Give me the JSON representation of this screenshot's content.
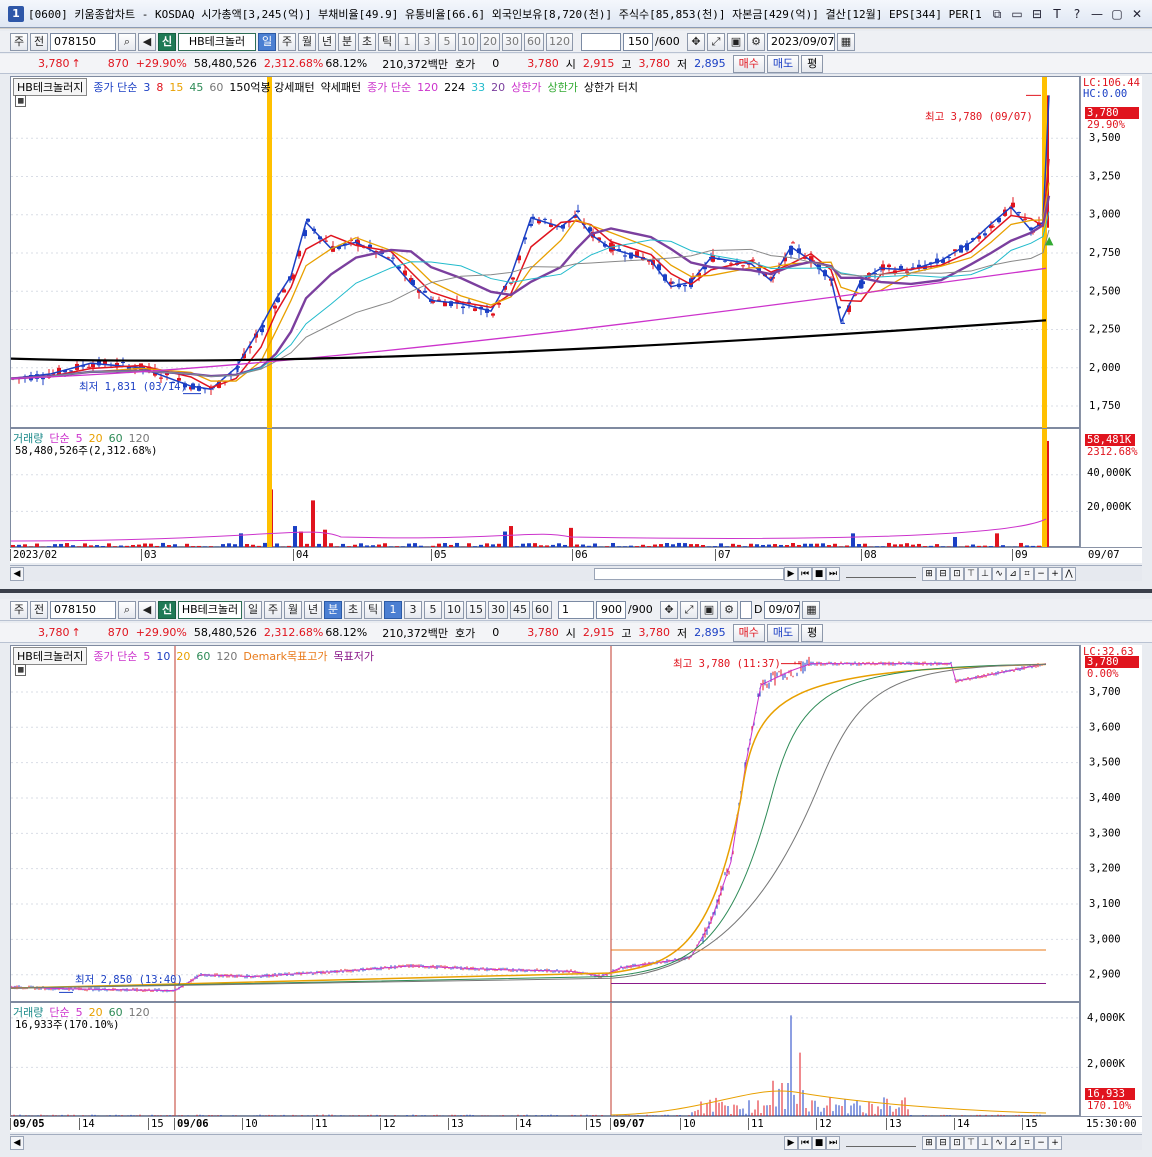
{
  "window": {
    "badge": "1",
    "title": "[0600] 키움종합차트 - KOSDAQ 시가총액[3,245(억)] 부채비율[49.9] 유통비율[66.6] 외국인보유[8,720(천)] 주식수[85,853(천)] 자본금[429(억)] 결산[12월] EPS[344] PER[1",
    "controls": [
      "⧉",
      "▭",
      "⊟",
      "T",
      "?",
      "—",
      "▢",
      "✕"
    ]
  },
  "top": {
    "toolbar": {
      "market": "주",
      "prev": "전",
      "code": "078150",
      "sin": "신",
      "indicator": "HB테크놀러",
      "periods": [
        "일",
        "주",
        "월",
        "년",
        "분",
        "초",
        "틱"
      ],
      "active_period": "일",
      "ticks": [
        "1",
        "3",
        "5",
        "10",
        "20",
        "30",
        "60",
        "120"
      ],
      "count": "150",
      "count_total": "/600",
      "date": "2023/09/07"
    },
    "quote": {
      "price": "3,780",
      "arrow": "↑",
      "change": "870",
      "rate": "+29.90%",
      "volume": "58,480,526",
      "vol_rate": "2,312.68%",
      "turnover": "68.12%",
      "amount": "210,372백만",
      "hoga_label": "호가",
      "hoga_val": "0",
      "cur": "3,780",
      "open_label": "시",
      "open": "2,915",
      "high_label": "고",
      "high": "3,780",
      "low_label": "저",
      "low": "2,895",
      "buy": "매수",
      "sell": "매도",
      "avg": "평"
    },
    "legend": {
      "box": "HB테크놀러지",
      "ma_label": "종가 단순",
      "ma": [
        "3",
        "8",
        "15",
        "45",
        "60"
      ],
      "p1": "150억봉 강세패턴",
      "p2": "약세패턴",
      "ma2_label": "종가 단순",
      "ma2": [
        "120",
        "224",
        "33",
        "20"
      ],
      "limit1": "상한가",
      "limit2": "상한가",
      "limit3": "상한가 터치"
    },
    "price_axis": [
      "3,500",
      "3,250",
      "3,000",
      "2,750",
      "2,500",
      "2,250",
      "2,000",
      "1,750"
    ],
    "lc": "LC:106.44",
    "hc": "HC:0.00",
    "last_price": "3,780",
    "last_rate": "29.90%",
    "high_note": "최고 3,780 (09/07)",
    "low_note": "최저 1,831 (03/14)",
    "vol_legend": {
      "label": "거래량",
      "ma_label": "단순",
      "ma": [
        "5",
        "20",
        "60",
        "120"
      ],
      "value": "58,480,526주(2,312.68%)"
    },
    "vol_axis": [
      "40,000K",
      "20,000K"
    ],
    "vol_last": "58,481K",
    "vol_rate": "2312.68%",
    "dates": [
      "2023/02",
      "03",
      "04",
      "05",
      "06",
      "07",
      "08",
      "09",
      "09/07"
    ]
  },
  "bottom": {
    "toolbar": {
      "market": "주",
      "prev": "전",
      "code": "078150",
      "sin": "신",
      "indicator": "HB테크놀러",
      "periods": [
        "일",
        "주",
        "월",
        "년",
        "분",
        "초",
        "틱"
      ],
      "active_period": "분",
      "ticks": [
        "1",
        "3",
        "5",
        "10",
        "15",
        "30",
        "45",
        "60"
      ],
      "active_tick": "1",
      "unit": "1",
      "count": "900",
      "count_total": "/900",
      "date": "09/07",
      "d_label": "D"
    },
    "quote": {
      "price": "3,780",
      "arrow": "↑",
      "change": "870",
      "rate": "+29.90%",
      "volume": "58,480,526",
      "vol_rate": "2,312.68%",
      "turnover": "68.12%",
      "amount": "210,372백만",
      "hoga_label": "호가",
      "hoga_val": "0",
      "cur": "3,780",
      "open_label": "시",
      "open": "2,915",
      "high_label": "고",
      "high": "3,780",
      "low_label": "저",
      "low": "2,895",
      "buy": "매수",
      "sell": "매도",
      "avg": "평"
    },
    "legend": {
      "box": "HB테크놀러지",
      "ma_label": "종가 단순",
      "ma": [
        "5",
        "10",
        "20",
        "60",
        "120"
      ],
      "demark_hi": "Demark목표고가",
      "demark_lo": "목표저가"
    },
    "price_axis": [
      "3,700",
      "3,600",
      "3,500",
      "3,400",
      "3,300",
      "3,200",
      "3,100",
      "3,000",
      "2,900"
    ],
    "lc": "LC:32.63",
    "last_price": "3,780",
    "last_rate": "0.00%",
    "high_note": "최고 3,780 (11:37)",
    "low_note": "최저 2,850 (13:40)",
    "vol_legend": {
      "label": "거래량",
      "ma_label": "단순",
      "ma": [
        "5",
        "20",
        "60",
        "120"
      ],
      "value": "16,933주(170.10%)"
    },
    "vol_axis": [
      "4,000K",
      "2,000K"
    ],
    "vol_last": "16,933",
    "vol_rate": "170.10%",
    "times": [
      "09/05",
      "14",
      "15",
      "09/06",
      "10",
      "11",
      "12",
      "13",
      "14",
      "15",
      "09/07",
      "10",
      "11",
      "12",
      "13",
      "14",
      "15",
      "15:30:00"
    ]
  },
  "colors": {
    "up": "#e0141e",
    "down": "#1b3fc4",
    "ma3": "#1b3fc4",
    "ma8": "#e0141e",
    "ma15": "#e8a000",
    "ma45": "#2e8b57",
    "ma60": "#7b3f9e",
    "ma120": "#cc33cc",
    "ma224": "#000000",
    "limit": "#ffc000"
  }
}
